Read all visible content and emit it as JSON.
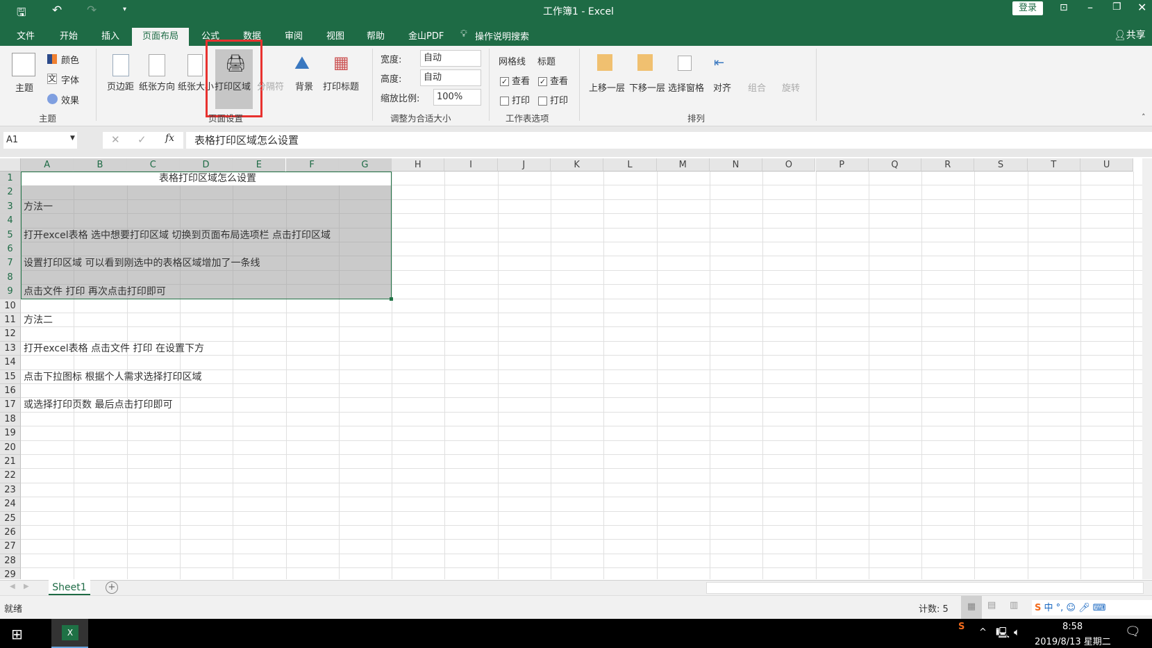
{
  "titlebar": {
    "title": "工作簿1  -  Excel",
    "login": "登录",
    "share": "共享"
  },
  "tabs": [
    "文件",
    "开始",
    "插入",
    "页面布局",
    "公式",
    "数据",
    "审阅",
    "视图",
    "帮助",
    "金山PDF"
  ],
  "active_tab": "页面布局",
  "search_label": "操作说明搜索",
  "ribbon": {
    "theme_group": {
      "label": "主题",
      "theme": "主题",
      "colors": "颜色",
      "fonts": "字体",
      "effects": "效果"
    },
    "page_setup_group": {
      "label": "页面设置",
      "margins": "页边距",
      "orientation": "纸张方向",
      "size": "纸张大小",
      "print_area": "打印区域",
      "breaks": "分隔符",
      "background": "背景",
      "print_titles": "打印标题"
    },
    "scale_group": {
      "label": "调整为合适大小",
      "width_label": "宽度:",
      "width_value": "自动",
      "height_label": "高度:",
      "height_value": "自动",
      "scale_label": "缩放比例:",
      "scale_value": "100%"
    },
    "sheet_options_group": {
      "label": "工作表选项",
      "gridlines": "网格线",
      "headings": "标题",
      "view": "查看",
      "print": "打印",
      "gridlines_view": true,
      "headings_view": true,
      "gridlines_print": false,
      "headings_print": false
    },
    "arrange_group": {
      "label": "排列",
      "bring_forward": "上移一层",
      "send_backward": "下移一层",
      "selection_pane": "选择窗格",
      "align": "对齐",
      "group": "组合",
      "rotate": "旋转"
    }
  },
  "formula_bar": {
    "name_box": "A1",
    "fx": "fx",
    "content": "表格打印区域怎么设置"
  },
  "columns": [
    "A",
    "B",
    "C",
    "D",
    "E",
    "F",
    "G",
    "H",
    "I",
    "J",
    "K",
    "L",
    "M",
    "N",
    "O",
    "P",
    "Q",
    "R",
    "S",
    "T",
    "U"
  ],
  "row_count": 29,
  "cells": [
    {
      "row": 1,
      "text": "表格打印区域怎么设置",
      "align": "center"
    },
    {
      "row": 3,
      "text": "方法一"
    },
    {
      "row": 5,
      "text": "打开excel表格  选中想要打印区域  切换到页面布局选项栏  点击打印区域"
    },
    {
      "row": 7,
      "text": "设置打印区域  可以看到刚选中的表格区域增加了一条线"
    },
    {
      "row": 9,
      "text": "点击文件  打印  再次点击打印即可"
    },
    {
      "row": 11,
      "text": "方法二"
    },
    {
      "row": 13,
      "text": "打开excel表格  点击文件  打印  在设置下方"
    },
    {
      "row": 15,
      "text": "点击下拉图标  根据个人需求选择打印区域"
    },
    {
      "row": 17,
      "text": "或选择打印页数  最后点击打印即可"
    }
  ],
  "selection": "A1:G9",
  "sheet_tabs": [
    "Sheet1"
  ],
  "status": {
    "ready": "就绪",
    "count": "计数: 5"
  },
  "taskbar": {
    "time": "8:58",
    "date": "2019/8/13 星期二",
    "ime": "中"
  },
  "colors": {
    "brand": "#1e6b45",
    "highlight_box": "#e8322f",
    "selection_fill": "#c8c8c8"
  }
}
